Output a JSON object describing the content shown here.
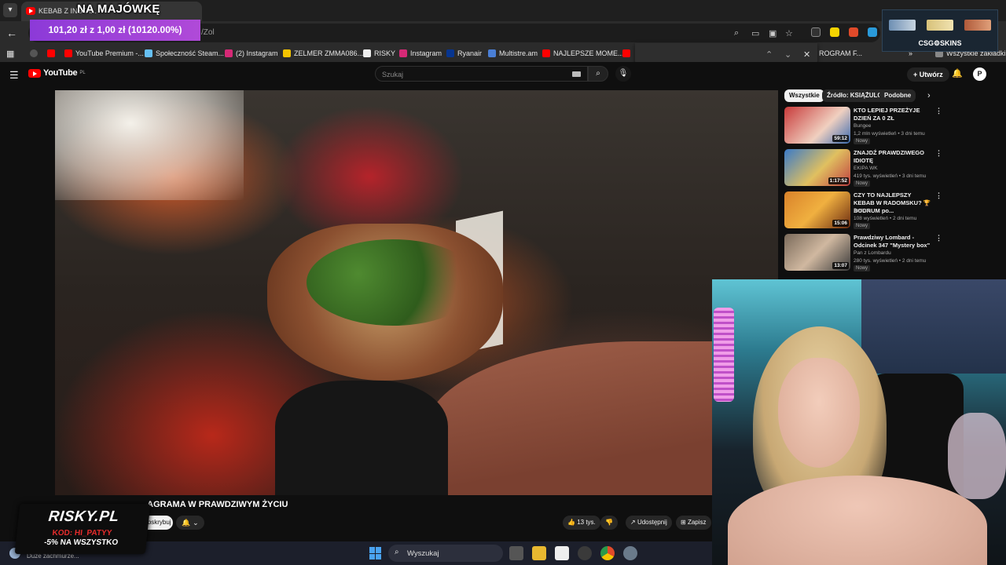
{
  "browser": {
    "tab_title": "KEBAB Z INSTA...",
    "overlay_title": "NA MAJÓWKĘ",
    "price_banner": "101,20 zł z 1,00 zł (10120.00%)",
    "url_fragment": "/Zol",
    "bookmarks": [
      {
        "label": "",
        "color": "#ff0000"
      },
      {
        "label": "YouTube Premium -...",
        "color": "#ff0000"
      },
      {
        "label": "Społeczność Steam...",
        "color": "#66c0f4"
      },
      {
        "label": "(2) Instagram",
        "color": "#d62976"
      },
      {
        "label": "ZELMER ZMMA086...",
        "color": "#f5c400"
      },
      {
        "label": "RISKY",
        "color": "#eeeeee"
      },
      {
        "label": "Instagram",
        "color": "#d62976"
      },
      {
        "label": "Ryanair",
        "color": "#073590"
      },
      {
        "label": "Multistre.am",
        "color": "#4a7fd6"
      },
      {
        "label": "NAJLEPSZE MOME...",
        "color": "#ff0000"
      }
    ],
    "bookmark_tail": "ROGRAM F...",
    "all_bookmarks": "Wszystkie zakładki",
    "skins_label": "CSG⚙SKINS"
  },
  "youtube": {
    "logo": "YouTube",
    "logo_region": "PL",
    "search_placeholder": "Szukaj",
    "create_label": "Utwórz",
    "avatar_letter": "P",
    "video_title": "...AGRAMA W PRAWDZIWYM ŻYCIU",
    "subscribe_label": "Subskrybuj",
    "likes": "13 tys.",
    "share_label": "Udostępnij",
    "save_label": "Zapisz",
    "chips": [
      "Wszystkie",
      "Źródło: KSIĄŻULO",
      "Podobne"
    ],
    "recommendations": [
      {
        "title": "KTO LEPIEJ PRZEŻYJE DZIEŃ ZA 0 ZŁ",
        "channel": "Bungee",
        "meta": "1,2 mln wyświetleń • 3 dni temu",
        "badge": "Nowy",
        "duration": "59:12",
        "thumb": "#c83a3a"
      },
      {
        "title": "ZNAJDŹ PRAWDZIWEGO IDIOTĘ",
        "channel": "EKIPA WK",
        "meta": "419 tys. wyświetleń • 3 dni temu",
        "badge": "Nowy",
        "duration": "1:17:52",
        "thumb": "#3a7ac8"
      },
      {
        "title": "CZY TO NAJLEPSZY KEBAB W RADOMSKU? 🏆 BODRUM po...",
        "channel": "Berlson",
        "meta": "108 wyświetleń • 2 dni temu",
        "badge": "Nowy",
        "duration": "15:06",
        "thumb": "#d9822a"
      },
      {
        "title": "Prawdziwy Lombard - Odcinek 347 \"Mystery box\"",
        "channel": "Pan z Lombardu",
        "meta": "280 tys. wyświetleń • 2 dni temu",
        "badge": "Nowy",
        "duration": "13:07",
        "thumb": "#7a6a5a"
      }
    ]
  },
  "sponsor": {
    "logo": "RISKY.PL",
    "code": "KOD: HI_PATYY",
    "discount": "-5% NA WSZYSTKO"
  },
  "taskbar": {
    "weather_text": "Duże zachmurze...",
    "search_label": "Wyszukaj"
  }
}
